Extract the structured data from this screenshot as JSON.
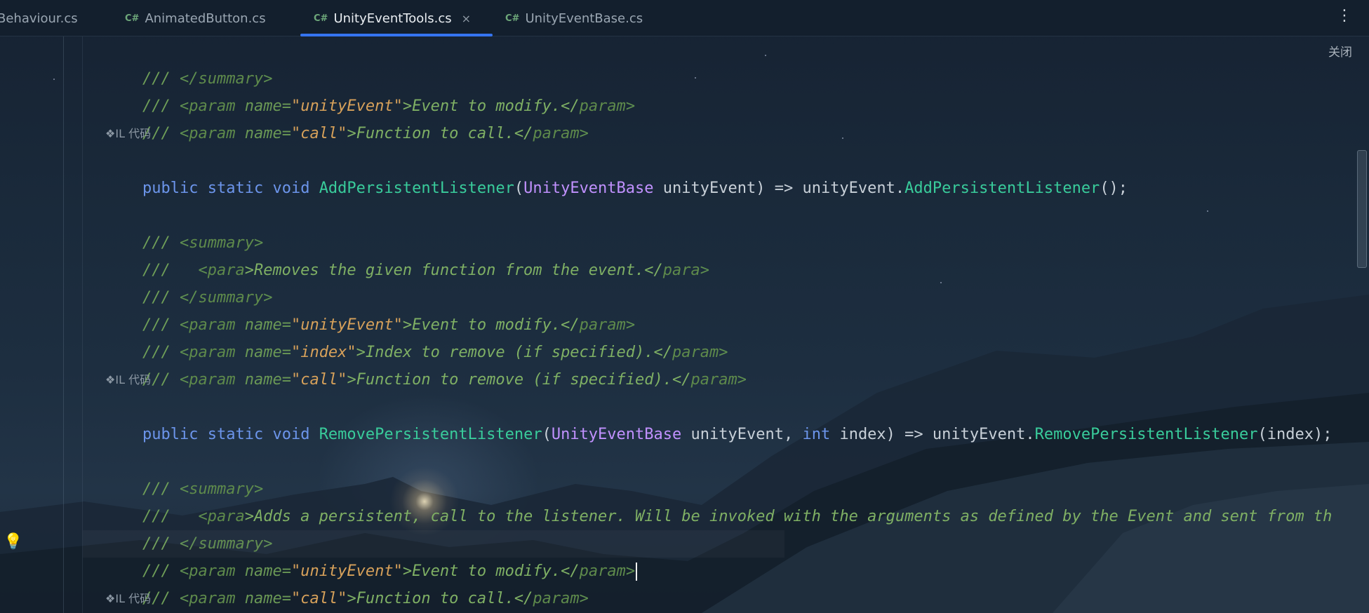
{
  "tabs": [
    {
      "icon": "",
      "label": "Behaviour.cs",
      "active": false
    },
    {
      "icon": "C#",
      "label": "AnimatedButton.cs",
      "active": false
    },
    {
      "icon": "C#",
      "label": "UnityEventTools.cs",
      "active": true,
      "close": "×"
    },
    {
      "icon": "C#",
      "label": "UnityEventBase.cs",
      "active": false
    }
  ],
  "toolbar": {
    "more_glyph": "⋮",
    "close_label": "关闭"
  },
  "gutter": {
    "bulb_glyph": "💡"
  },
  "hints": {
    "il_code": "❖IL 代码"
  },
  "code": {
    "l1": [
      "///",
      " <",
      "/",
      "summary",
      ">"
    ],
    "l2": [
      "///",
      " <",
      "param",
      " name=",
      "\"unityEvent\"",
      ">Event to modify.</",
      "param",
      ">"
    ],
    "l3": [
      "///",
      " <",
      "param",
      " name=",
      "\"call\"",
      ">Function to call.</",
      "param",
      ">"
    ],
    "l5": [
      "public",
      " ",
      "static",
      " ",
      "void",
      " ",
      "AddPersistentListener",
      "(",
      "UnityEventBase",
      " unityEvent) => unityEvent.",
      "AddPersistentListener",
      "();"
    ],
    "l7": [
      "///",
      " <",
      "summary",
      ">"
    ],
    "l8": [
      "///",
      "   <",
      "para",
      ">Removes the given function from the event.</",
      "para",
      ">"
    ],
    "l9": [
      "///",
      " <",
      "/",
      "summary",
      ">"
    ],
    "l10": [
      "///",
      " <",
      "param",
      " name=",
      "\"unityEvent\"",
      ">Event to modify.</",
      "param",
      ">"
    ],
    "l11": [
      "///",
      " <",
      "param",
      " name=",
      "\"index\"",
      ">Index to remove (if specified).</",
      "param",
      ">"
    ],
    "l12": [
      "///",
      " <",
      "param",
      " name=",
      "\"call\"",
      ">Function to remove (if specified).</",
      "param",
      ">"
    ],
    "l14": [
      "public",
      " ",
      "static",
      " ",
      "void",
      " ",
      "RemovePersistentListener",
      "(",
      "UnityEventBase",
      " unityEvent, ",
      "int",
      " index) => unityEvent.",
      "RemovePersistentListener",
      "(index);"
    ],
    "l16": [
      "///",
      " <",
      "summary",
      ">"
    ],
    "l17": [
      "///",
      "   <",
      "para",
      ">Adds a persistent, call to the listener. Will be invoked with the arguments as defined by the Event and sent from th"
    ],
    "l18": [
      "///",
      " <",
      "/",
      "summary",
      ">"
    ],
    "l19": [
      "///",
      " <",
      "param",
      " name=",
      "\"unityEvent\"",
      ">Event to modify.</",
      "param",
      ">"
    ],
    "l20": [
      "///",
      " <",
      "param",
      " name=",
      "\"call\"",
      ">Function to call.</",
      "param",
      ">"
    ]
  }
}
